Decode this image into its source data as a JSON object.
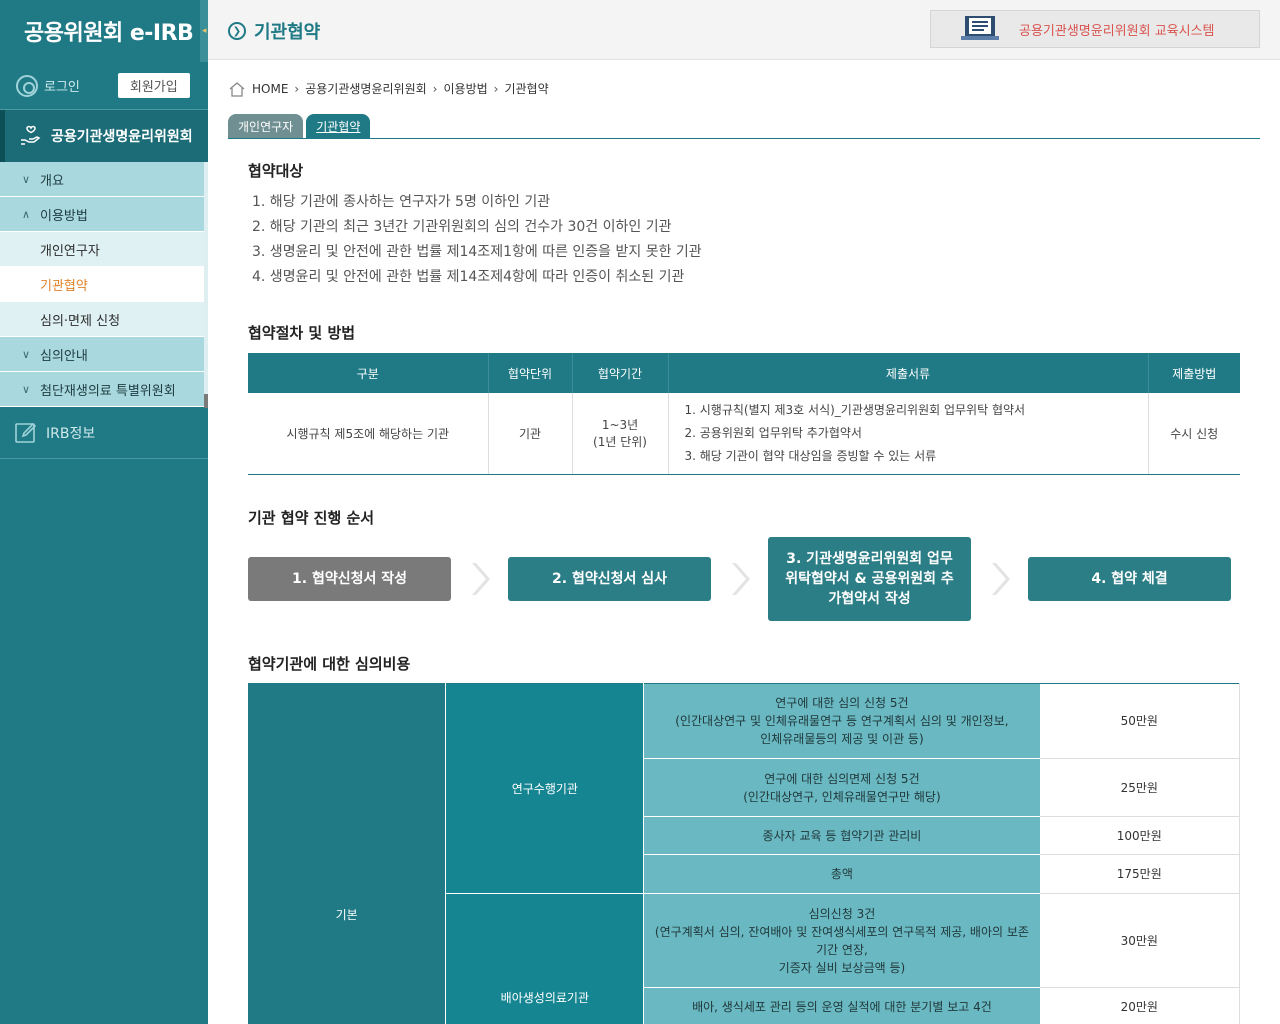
{
  "sidebar": {
    "logo": "공용위원회 e-IRB",
    "toggle": "◂",
    "login": "로그인",
    "signup": "회원가입",
    "section": "공용기관생명윤리위원회",
    "items": [
      {
        "label": "개요",
        "chev": "∨"
      },
      {
        "label": "이용방법",
        "chev": "∧"
      }
    ],
    "subitems": [
      {
        "label": "개인연구자"
      },
      {
        "label": "기관협약"
      },
      {
        "label": "심의·면제 신청"
      }
    ],
    "items2": [
      {
        "label": "심의안내",
        "chev": "∨"
      },
      {
        "label": "첨단재생의료 특별위원회",
        "chev": "∨"
      }
    ],
    "irb": "IRB정보"
  },
  "topbar": {
    "title": "기관협약",
    "edu": "공용기관생명윤리위원회 교육시스템"
  },
  "breadcrumb": [
    "HOME",
    "공용기관생명윤리위원회",
    "이용방법",
    "기관협약"
  ],
  "tabs": [
    {
      "label": "개인연구자"
    },
    {
      "label": "기관협약"
    }
  ],
  "target": {
    "title": "협약대상",
    "items": [
      "1. 해당 기관에 종사하는 연구자가 5명 이하인 기관",
      "2. 해당 기관의 최근 3년간 기관위원회의 심의 건수가 30건 이하인 기관",
      "3. 생명윤리 및 안전에 관한 법률 제14조제1항에 따른 인증을 받지 못한 기관",
      "4. 생명윤리 및 안전에 관한 법률 제14조제4항에 따라 인증이 취소된 기관"
    ]
  },
  "procedure": {
    "title": "협약절차 및 방법",
    "headers": [
      "구분",
      "협약단위",
      "협약기간",
      "제출서류",
      "제출방법"
    ],
    "row": {
      "type": "시행규칙 제5조에 해당하는 기관",
      "unit": "기관",
      "period1": "1~3년",
      "period2": "(1년 단위)",
      "docs": [
        "1. 시행규칙(별지 제3호 서식)_기관생명윤리위원회 업무위탁 협약서",
        "2. 공용위원회 업무위탁 추가협약서",
        "3. 해당 기관이 협약 대상임을 증빙할 수 있는 서류"
      ],
      "method": "수시 신청"
    }
  },
  "steps": {
    "title": "기관 협약 진행 순서",
    "list": [
      "1. 협약신청서 작성",
      "2. 협약신청서 심사",
      "3. 기관생명윤리위원회 업무위탁협약서 & 공용위원회 추가협약서 작성",
      "4. 협약 체결"
    ]
  },
  "fees": {
    "title": "협약기관에 대한 심의비용",
    "basic": "기본",
    "org1": "연구수행기관",
    "org2": "배아생성의료기관",
    "rows": [
      {
        "desc": [
          "연구에 대한 심의 신청 5건",
          "(인간대상연구 및 인체유래물연구 등 연구계획서 심의 및 개인정보,",
          "인체유래물등의 제공 및 이관 등)"
        ],
        "amount": "50만원"
      },
      {
        "desc": [
          "연구에 대한 심의면제 신청 5건",
          "(인간대상연구, 인체유래물연구만 해당)"
        ],
        "amount": "25만원"
      },
      {
        "desc": [
          "종사자 교육 등 협약기관 관리비"
        ],
        "amount": "100만원"
      },
      {
        "desc": [
          "총액"
        ],
        "amount": "175만원"
      },
      {
        "desc": [
          "심의신청 3건",
          "(연구계획서 심의, 잔여배아 및 잔여생식세포의 연구목적 제공, 배아의 보존",
          "기간 연장,",
          "기증자 실비 보상금액 등)"
        ],
        "amount": "30만원"
      },
      {
        "desc": [
          "배아, 생식세포 관리 등의 운영 실적에 대한 분기별 보고 4건"
        ],
        "amount": "20만원"
      }
    ]
  }
}
